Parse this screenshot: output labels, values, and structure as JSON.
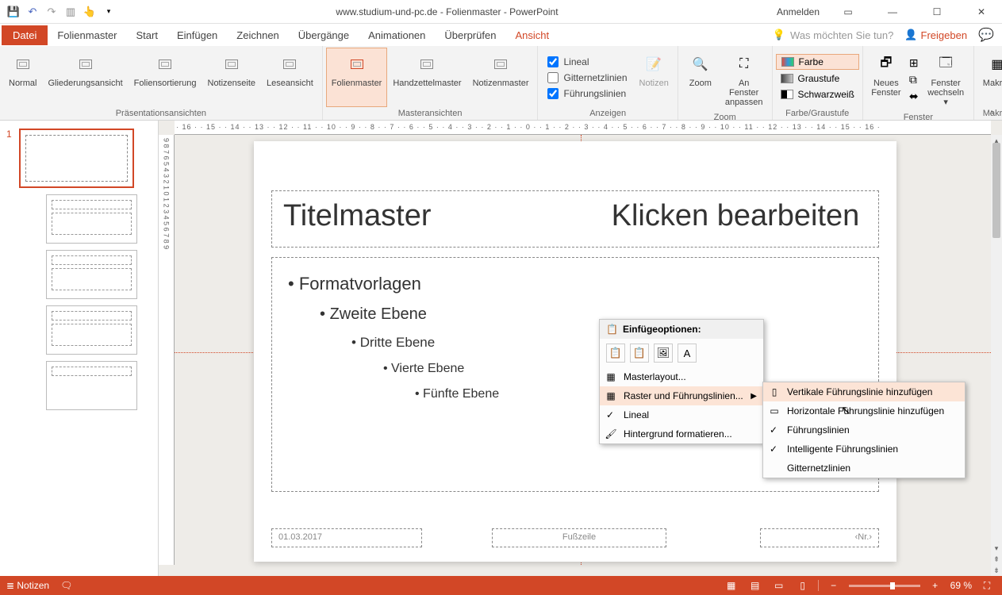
{
  "title": "www.studium-und-pc.de - Folienmaster - PowerPoint",
  "anmelden": "Anmelden",
  "menu": {
    "file": "Datei",
    "folienmaster": "Folienmaster",
    "start": "Start",
    "einfuegen": "Einfügen",
    "zeichnen": "Zeichnen",
    "uebergaenge": "Übergänge",
    "animationen": "Animationen",
    "ueberpruefen": "Überprüfen",
    "ansicht": "Ansicht",
    "tell_me": "Was möchten Sie tun?",
    "freigeben": "Freigeben"
  },
  "ribbon": {
    "normal": "Normal",
    "gliederung": "Gliederungsansicht",
    "foliensort": "Foliensortierung",
    "notizseite": "Notizenseite",
    "leseansicht": "Leseansicht",
    "group_praes": "Präsentationsansichten",
    "folienmaster": "Folienmaster",
    "handzettel": "Handzettelmaster",
    "notizmaster": "Notizenmaster",
    "group_master": "Masteransichten",
    "lineal": "Lineal",
    "gitter": "Gitternetzlinien",
    "fuehrung": "Führungslinien",
    "group_anzeigen": "Anzeigen",
    "notizen": "Notizen",
    "zoom": "Zoom",
    "anfenster": "An Fenster anpassen",
    "group_zoom": "Zoom",
    "farbe": "Farbe",
    "graustufe": "Graustufe",
    "schwarzweiss": "Schwarzweiß",
    "group_farbe": "Farbe/Graustufe",
    "neuesfenster": "Neues Fenster",
    "fensterwechseln": "Fenster wechseln",
    "group_fenster": "Fenster",
    "makros": "Makros",
    "group_makros": "Makros"
  },
  "slide": {
    "title_before": "Titelmaster",
    "title_after": "Klicken bearbeiten",
    "lvl1": "Formatvorlagen",
    "lvl2": "Zweite Ebene",
    "lvl3": "Dritte Ebene",
    "lvl4": "Vierte Ebene",
    "lvl5": "Fünfte Ebene",
    "date": "01.03.2017",
    "footer": "Fußzeile",
    "num": "‹Nr.›"
  },
  "ruler_h": "· 16 · · 15 · · 14 · · 13 · · 12 · · 11 · · 10 · · 9 · · 8 · · 7 · · 6 · · 5 · · 4 · · 3 · · 2 · · 1 · · 0 · · 1 · · 2 · · 3 · · 4 · · 5 · · 6 · · 7 · · 8 · · 9 · · 10 · · 11 · · 12 · · 13 · · 14 · · 15 · · 16 ·",
  "ruler_v": "9  8  7  6  5  4  3  2  1  0  1  2  3  4  5  6  7  8  9",
  "ctx1": {
    "header": "Einfügeoptionen:",
    "masterlayout": "Masterlayout...",
    "raster": "Raster und Führungslinien...",
    "lineal": "Lineal",
    "hintergrund": "Hintergrund formatieren..."
  },
  "ctx2": {
    "vertikale": "Vertikale Führungslinie hinzufügen",
    "horizontale": "Horizontale Führungslinie hinzufügen",
    "fuehrungslinien": "Führungslinien",
    "intelligente": "Intelligente Führungslinien",
    "gitternetz": "Gitternetzlinien"
  },
  "status": {
    "notizen": "Notizen",
    "zoom": "69 %"
  },
  "thumb_num": "1"
}
